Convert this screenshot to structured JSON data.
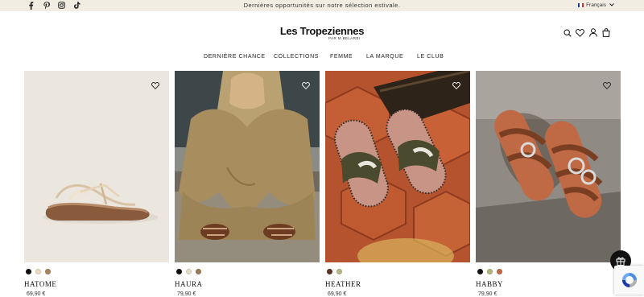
{
  "topbar": {
    "announcement": "Dernières opportunités sur notre sélection estivale.",
    "language": "Français",
    "social": [
      "facebook-icon",
      "pinterest-icon",
      "instagram-icon",
      "tiktok-icon"
    ]
  },
  "header": {
    "logo": "Les Tropeziennes",
    "logo_sub": "PAR M.BELARBI",
    "icons": [
      "search-icon",
      "heart-icon",
      "account-icon",
      "bag-icon"
    ]
  },
  "nav": {
    "items": [
      "DERNIÈRE CHANCE",
      "COLLECTIONS",
      "FEMME",
      "LA MARQUE",
      "LE CLUB"
    ]
  },
  "products": [
    {
      "name": "HATOME",
      "price": "69,90 €",
      "swatches": [
        "#111111",
        "#e8dcc0",
        "#a9835f"
      ]
    },
    {
      "name": "HAURA",
      "price": "79,90 €",
      "swatches": [
        "#111111",
        "#e6dbc3",
        "#9c7a5a"
      ]
    },
    {
      "name": "HEATHER",
      "price": "69,90 €",
      "swatches": [
        "#5a3324",
        "#b7b58a"
      ]
    },
    {
      "name": "HABBY",
      "price": "79,90 €",
      "swatches": [
        "#111111",
        "#b5b07a",
        "#c06a45"
      ]
    }
  ],
  "colors": {
    "topbar_bg": "#f1ede3",
    "accent": "#111111"
  }
}
